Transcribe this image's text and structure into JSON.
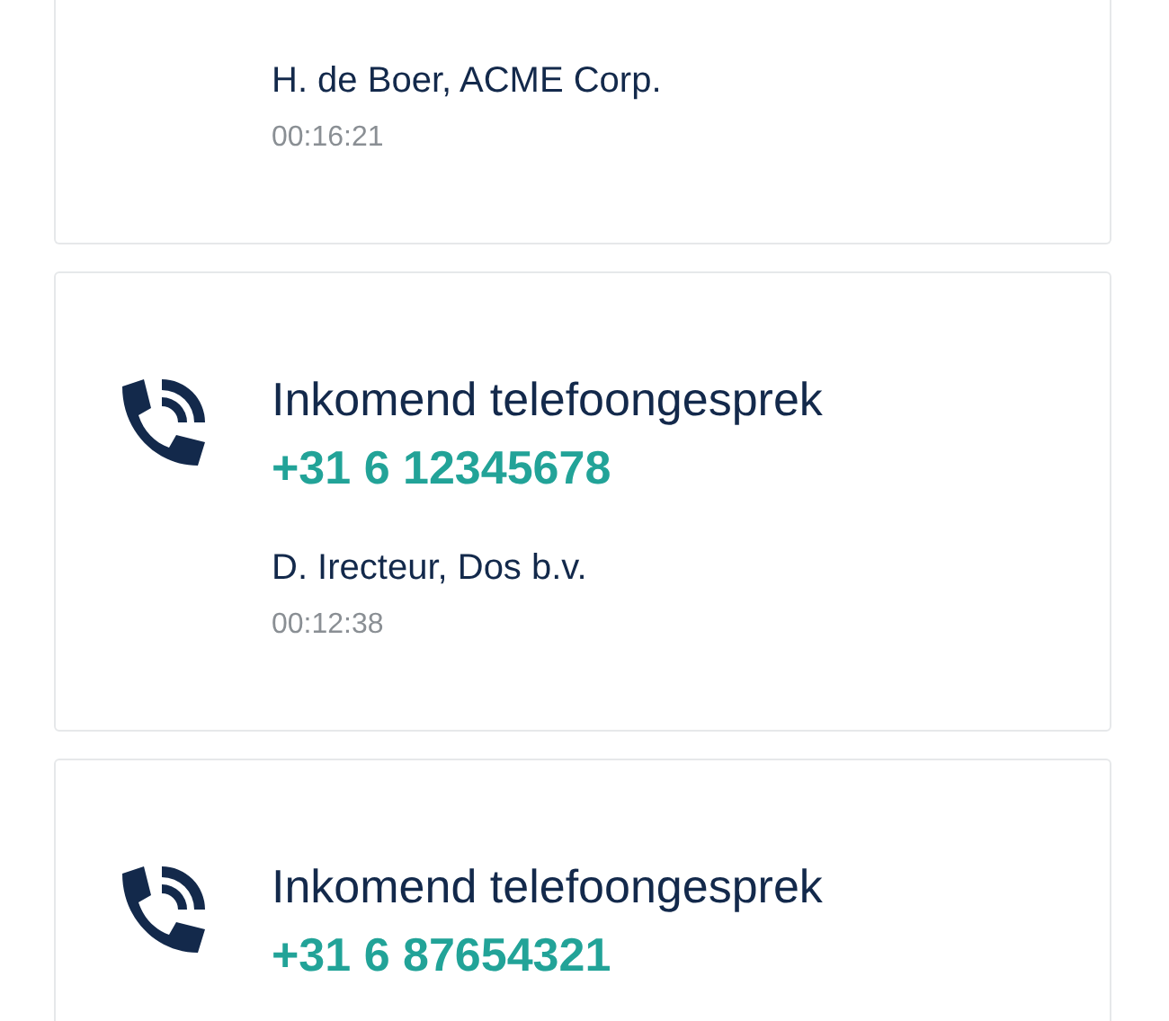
{
  "calls": [
    {
      "contact": "H. de Boer, ACME Corp.",
      "duration": "00:16:21"
    },
    {
      "title": "Inkomend telefoongesprek",
      "number": "+31 6 12345678",
      "contact": "D. Irecteur, Dos b.v.",
      "duration": "00:12:38"
    },
    {
      "title": "Inkomend telefoongesprek",
      "number": "+31 6 87654321"
    }
  ]
}
